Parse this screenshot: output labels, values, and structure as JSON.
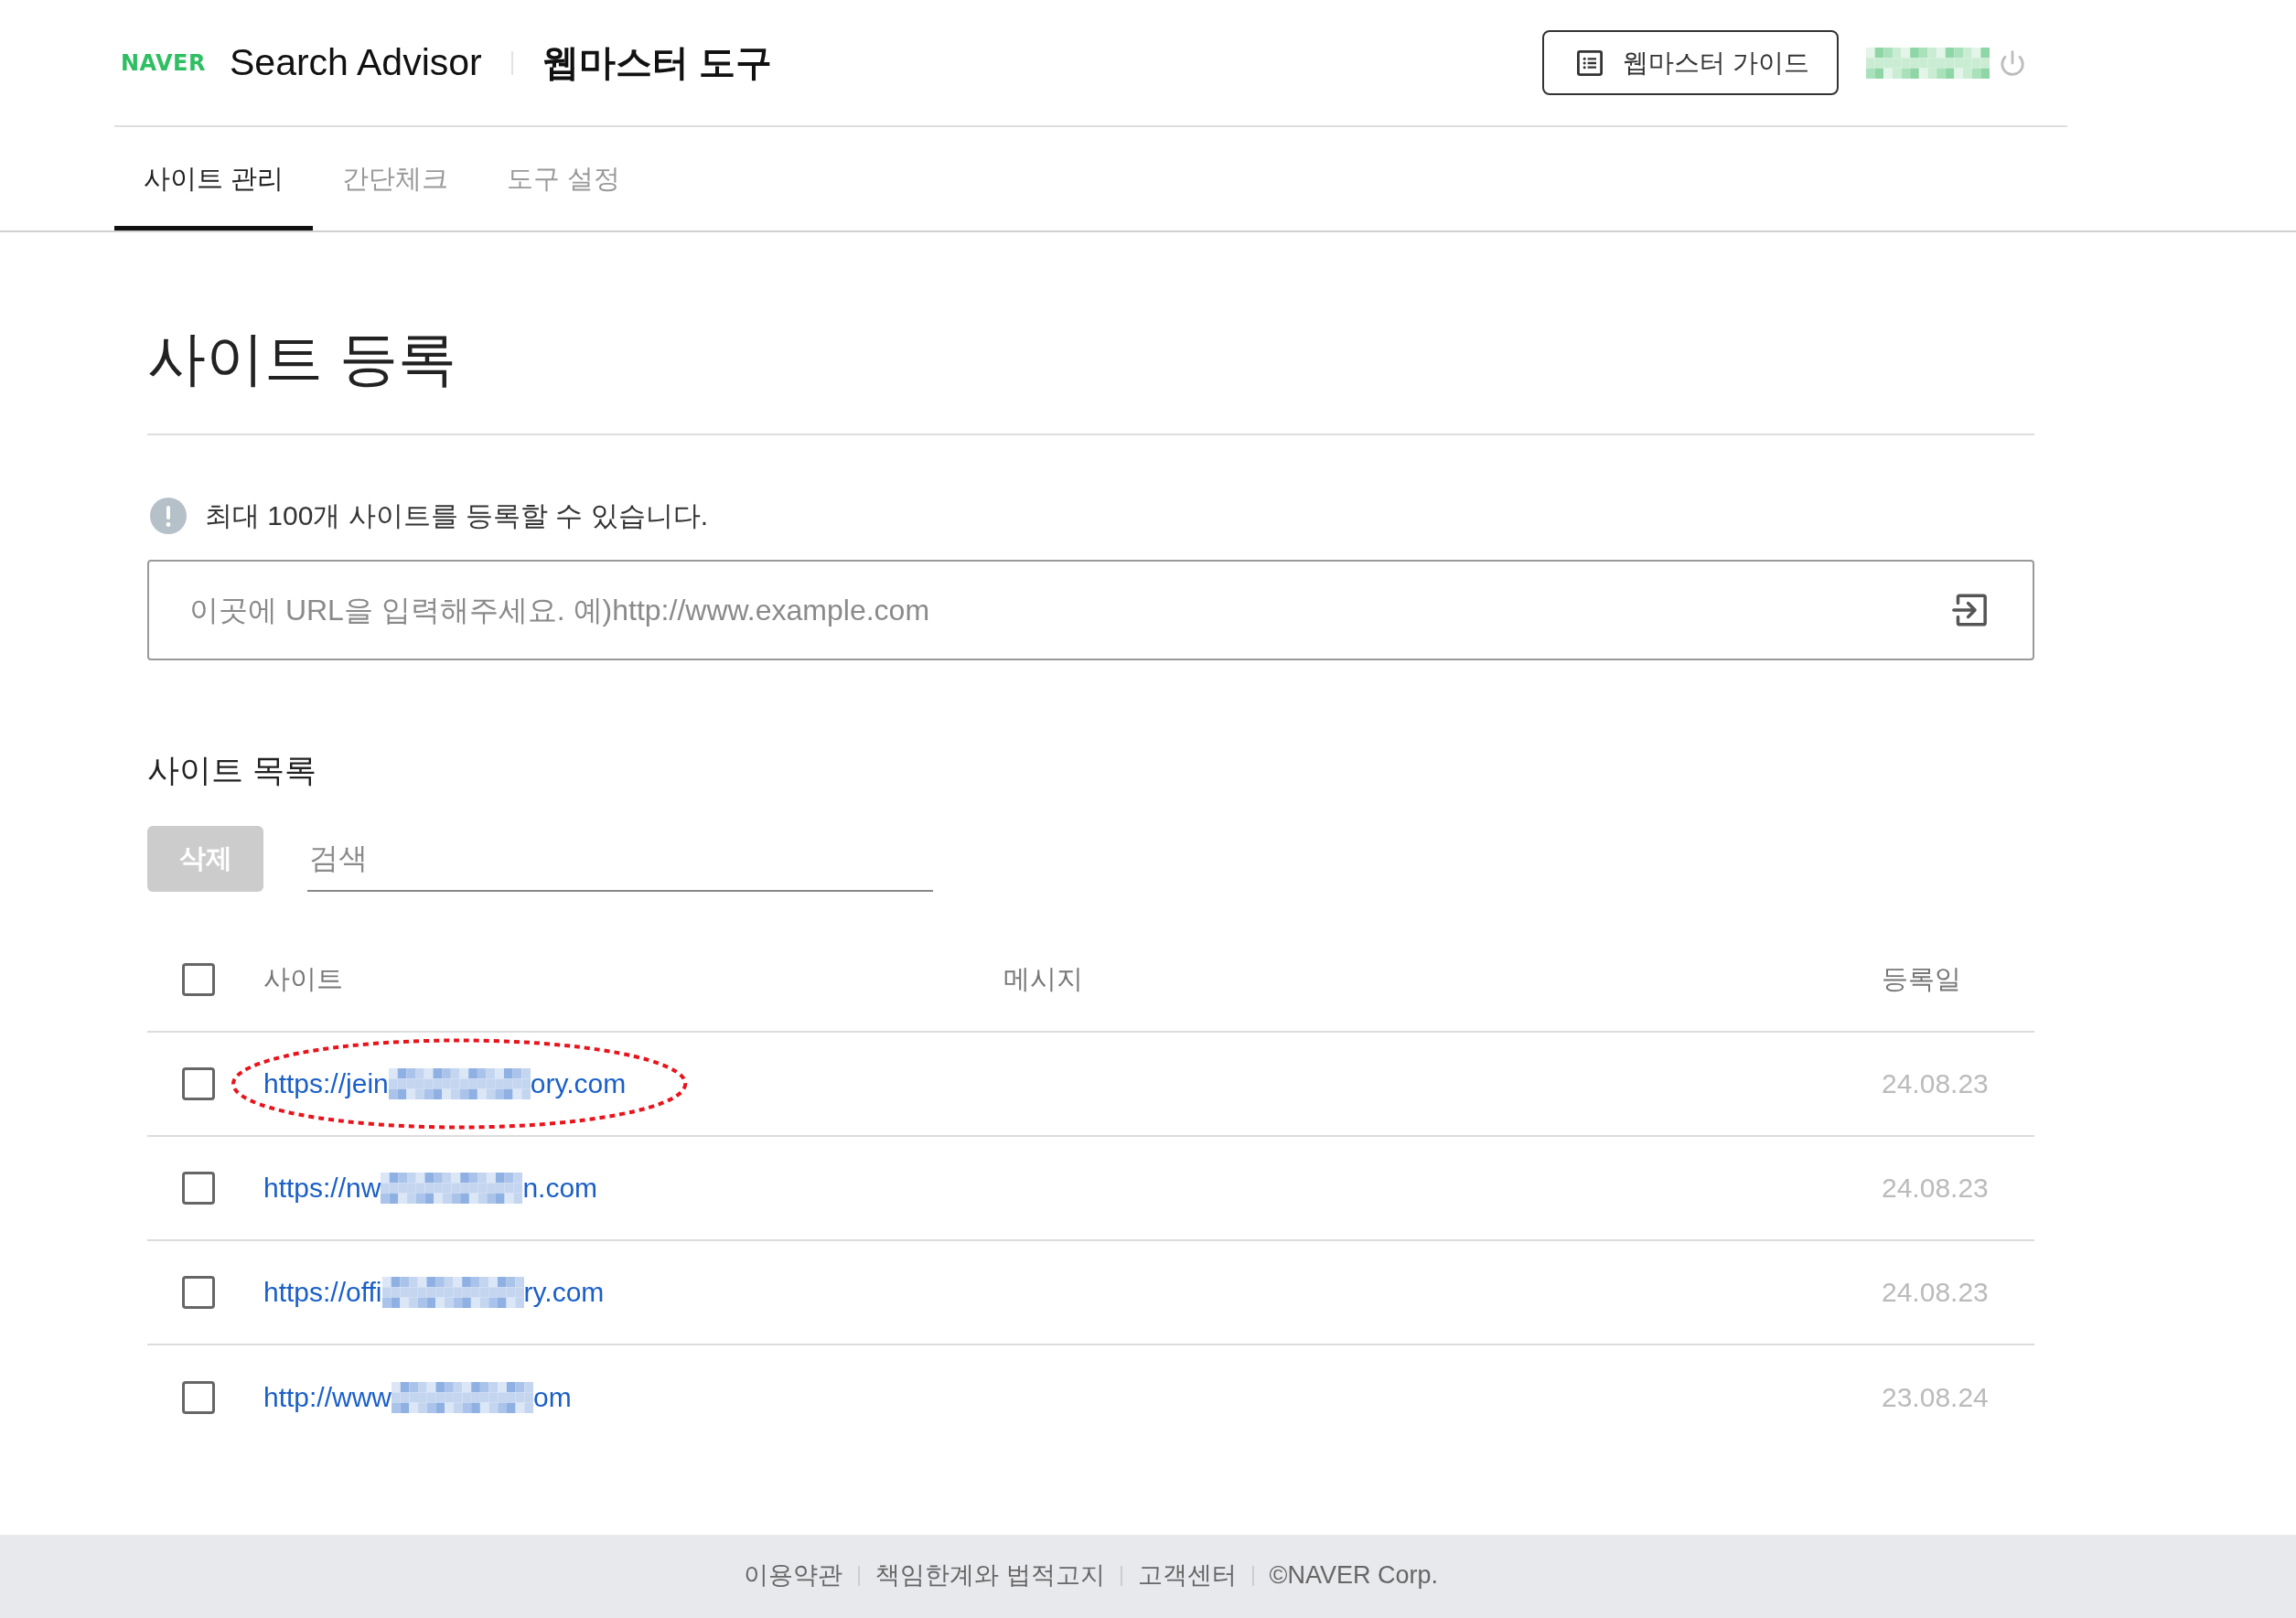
{
  "header": {
    "logo": "NAVER",
    "product": "Search Advisor",
    "title": "웹마스터 도구",
    "guide_button": "웹마스터 가이드",
    "account": {
      "redacted": true
    }
  },
  "tabs": [
    {
      "label": "사이트 관리",
      "selected": true
    },
    {
      "label": "간단체크",
      "selected": false
    },
    {
      "label": "도구 설정",
      "selected": false
    }
  ],
  "register": {
    "title": "사이트 등록",
    "notice": "최대 100개 사이트를 등록할 수 있습니다.",
    "url_input": {
      "placeholder": "이곳에 URL을 입력해주세요. 예)http://www.example.com"
    }
  },
  "site_list": {
    "title": "사이트 목록",
    "delete_button": {
      "label": "삭제",
      "disabled": true
    },
    "search": {
      "placeholder": "검색"
    },
    "columns": [
      "사이트",
      "메시지",
      "등록일"
    ],
    "select_all": {
      "checked": false
    },
    "rows": [
      {
        "checked": false,
        "url_start": "https://jein",
        "url_end": "ory.com",
        "redacted": true,
        "date": "24.08.23",
        "circled": true
      },
      {
        "checked": false,
        "url_start": "https://nw",
        "url_end": "n.com",
        "redacted": true,
        "date": "24.08.23",
        "circled": false
      },
      {
        "checked": false,
        "url_start": "https://offi",
        "url_end": "ry.com",
        "redacted": true,
        "date": "24.08.23",
        "circled": false
      },
      {
        "checked": false,
        "url_start": "http://www",
        "url_end": "om",
        "redacted": true,
        "date": "23.08.24",
        "circled": false
      }
    ]
  },
  "footer": {
    "links": [
      "이용약관",
      "책임한계와 법적고지",
      "고객센터"
    ],
    "copyright": "©NAVER Corp."
  }
}
